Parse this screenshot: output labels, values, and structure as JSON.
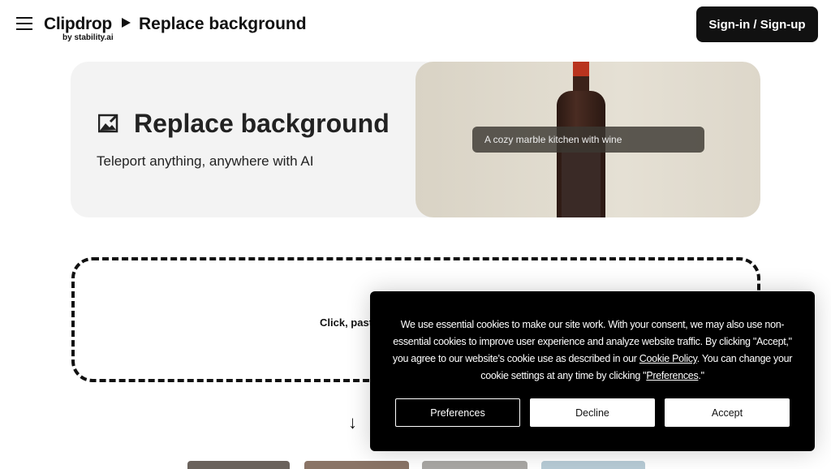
{
  "header": {
    "logo": "Clipdrop",
    "logo_sub": "by stability.ai",
    "breadcrumb": "Replace background",
    "signin_label": "Sign-in / Sign-up"
  },
  "hero": {
    "title": "Replace background",
    "subtitle": "Teleport anything, anywhere with AI",
    "prompt_example": "A cozy marble kitchen with wine"
  },
  "dropzone": {
    "text": "Click, past"
  },
  "cookie": {
    "text_1": "We use essential cookies to make our site work. With your consent, we may also use non-essential cookies to improve user experience and analyze website traffic. By clicking \"Accept,\" you agree to our website's cookie use as described in our ",
    "policy_link": "Cookie Policy",
    "text_2": ". You can change your cookie settings at any time by clicking \"",
    "preferences_link": "Preferences",
    "text_3": ".\"",
    "preferences_label": "Preferences",
    "decline_label": "Decline",
    "accept_label": "Accept"
  }
}
